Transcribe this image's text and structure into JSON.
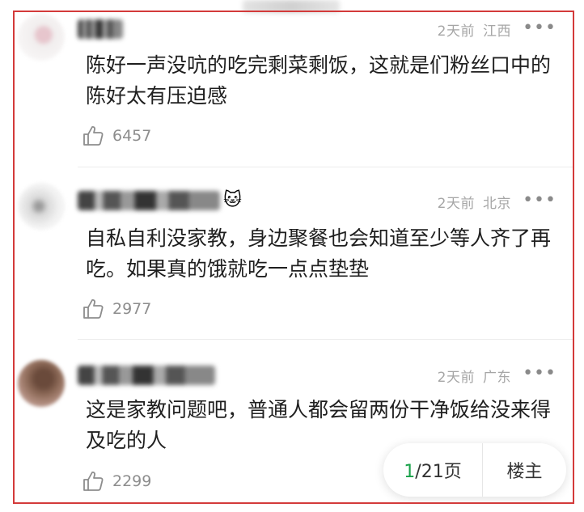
{
  "comments": [
    {
      "time": "2天前",
      "location": "江西",
      "text": "陈好一声没吭的吃完剩菜剩饭，这就是们粉丝口中的陈好太有压迫感",
      "likes": "6457",
      "more": "•••"
    },
    {
      "time": "2天前",
      "location": "北京",
      "text": "自私自利没家教，身边聚餐也会知道至少等人齐了再吃。如果真的饿就吃一点点垫垫",
      "likes": "2977",
      "more": "•••"
    },
    {
      "time": "2天前",
      "location": "广东",
      "text": "这是家教问题吧，普通人都会留两份干净饭给没来得及吃的人",
      "likes": "2299",
      "more": "•••"
    }
  ],
  "pager": {
    "current": "1",
    "total": "/21页",
    "op_label": "楼主"
  },
  "icons": {
    "like": "thumbs-up-icon",
    "more": "more-dots-icon",
    "cat": "cat-emoji-icon"
  },
  "colors": {
    "frame_border": "#d33a3a",
    "page_current": "#19a24a",
    "meta_text": "#a6a6a6"
  }
}
